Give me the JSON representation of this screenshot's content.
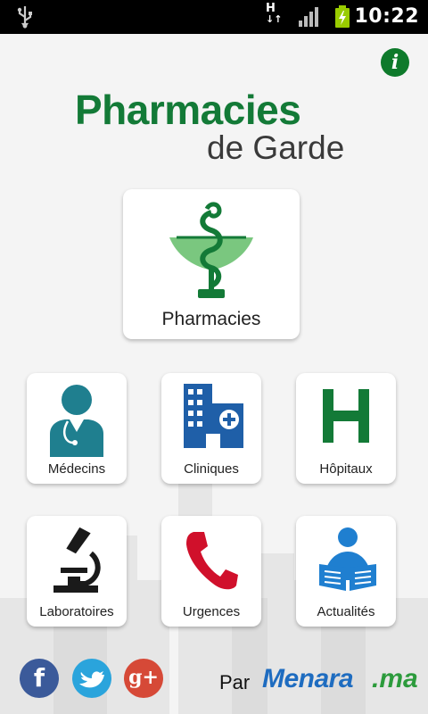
{
  "status_bar": {
    "network_type": "H",
    "time": "10:22",
    "icons": [
      "usb-icon",
      "signal-icon",
      "battery-charging-icon"
    ]
  },
  "header": {
    "info_button_glyph": "i",
    "title": "Pharmacies",
    "subtitle": "de Garde"
  },
  "tiles": {
    "pharmacies": {
      "label": "Pharmacies",
      "icon": "pharmacy-caduceus-icon"
    },
    "medecins": {
      "label": "Médecins",
      "icon": "doctor-icon"
    },
    "cliniques": {
      "label": "Cliniques",
      "icon": "clinic-building-icon"
    },
    "hopitaux": {
      "label": "Hôpitaux",
      "icon": "hospital-h-icon"
    },
    "laboratoires": {
      "label": "Laboratoires",
      "icon": "microscope-icon"
    },
    "urgences": {
      "label": "Urgences",
      "icon": "phone-icon"
    },
    "actualites": {
      "label": "Actualités",
      "icon": "reader-news-icon"
    }
  },
  "footer": {
    "social": [
      {
        "name": "facebook",
        "glyph": "f"
      },
      {
        "name": "twitter",
        "glyph": "🐦"
      },
      {
        "name": "google-plus",
        "glyph": "g+"
      }
    ],
    "by_label": "Par",
    "brand_name": "Menara",
    "brand_tld": ".ma"
  },
  "colors": {
    "brand_green": "#137a37",
    "icon_teal": "#1f7f8f",
    "icon_blue": "#1f5fa8",
    "urgent_red": "#d0102b",
    "menara_blue": "#1e6cc0",
    "menara_green": "#2c9b3c"
  }
}
